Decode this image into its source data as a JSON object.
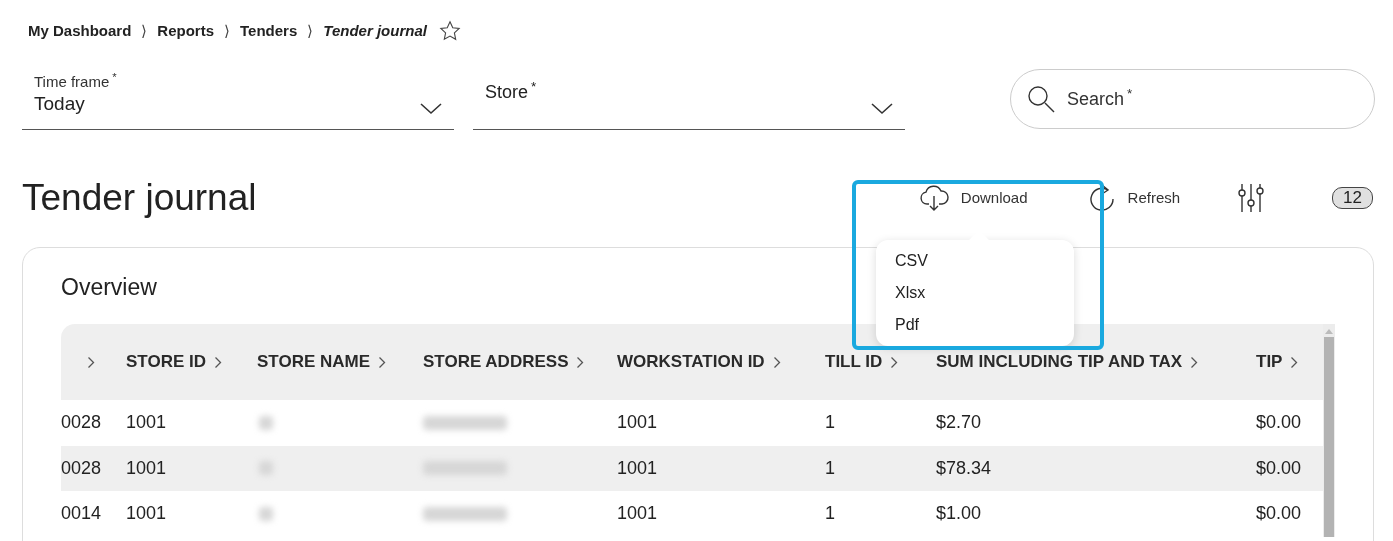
{
  "breadcrumb": [
    {
      "label": "My Dashboard",
      "current": false
    },
    {
      "separator": "⟩",
      "label": "Reports",
      "current": false
    },
    {
      "separator": "⟩",
      "label": "Tenders",
      "current": false
    },
    {
      "separator": "⟩",
      "label": "Tender journal",
      "current": true
    }
  ],
  "favorite": {
    "on": false
  },
  "filters": [
    {
      "label": "Time frame",
      "required_mark": "*",
      "value": "Today"
    },
    {
      "label": "Store",
      "required_mark": "*"
    }
  ],
  "search": {
    "placeholder": "Search",
    "required_mark": "*"
  },
  "title": "Tender journal",
  "actions": [
    {
      "kind": "download",
      "label": "Download"
    },
    {
      "kind": "refresh",
      "label": "Refresh"
    },
    {
      "kind": "filter"
    }
  ],
  "count": "12",
  "download_menu": {
    "items": [
      "CSV",
      "Xlsx",
      "Pdf"
    ]
  },
  "overview": {
    "title": "Overview",
    "table": {
      "columns": [
        {},
        {
          "label": "STORE ID"
        },
        {
          "label": "STORE NAME"
        },
        {
          "label": "STORE ADDRESS"
        },
        {
          "label": "WORKSTATION ID"
        },
        {
          "label": "TILL ID"
        },
        {
          "label": "SUM INCLUDING TIP AND TAX"
        },
        {
          "label": "TIP"
        }
      ],
      "rows": [
        {
          "cells": [
            {
              "kind": "text",
              "text": "0028"
            },
            {
              "kind": "text",
              "text": "1001"
            },
            {
              "kind": "blurred"
            },
            {
              "kind": "blurred"
            },
            {
              "kind": "text",
              "text": "1001"
            },
            {
              "kind": "text",
              "text": "1"
            },
            {
              "kind": "text",
              "text": "$2.70"
            },
            {
              "kind": "text",
              "text": "$0.00"
            }
          ]
        },
        {
          "cells": [
            {
              "kind": "text",
              "text": "0028"
            },
            {
              "kind": "text",
              "text": "1001"
            },
            {
              "kind": "blurred"
            },
            {
              "kind": "blurred"
            },
            {
              "kind": "text",
              "text": "1001"
            },
            {
              "kind": "text",
              "text": "1"
            },
            {
              "kind": "text",
              "text": "$78.34"
            },
            {
              "kind": "text",
              "text": "$0.00"
            }
          ]
        },
        {
          "cells": [
            {
              "kind": "text",
              "text": "0014"
            },
            {
              "kind": "text",
              "text": "1001"
            },
            {
              "kind": "blurred"
            },
            {
              "kind": "blurred"
            },
            {
              "kind": "text",
              "text": "1001"
            },
            {
              "kind": "text",
              "text": "1"
            },
            {
              "kind": "text",
              "text": "$1.00"
            },
            {
              "kind": "text",
              "text": "$0.00"
            }
          ]
        }
      ]
    }
  }
}
